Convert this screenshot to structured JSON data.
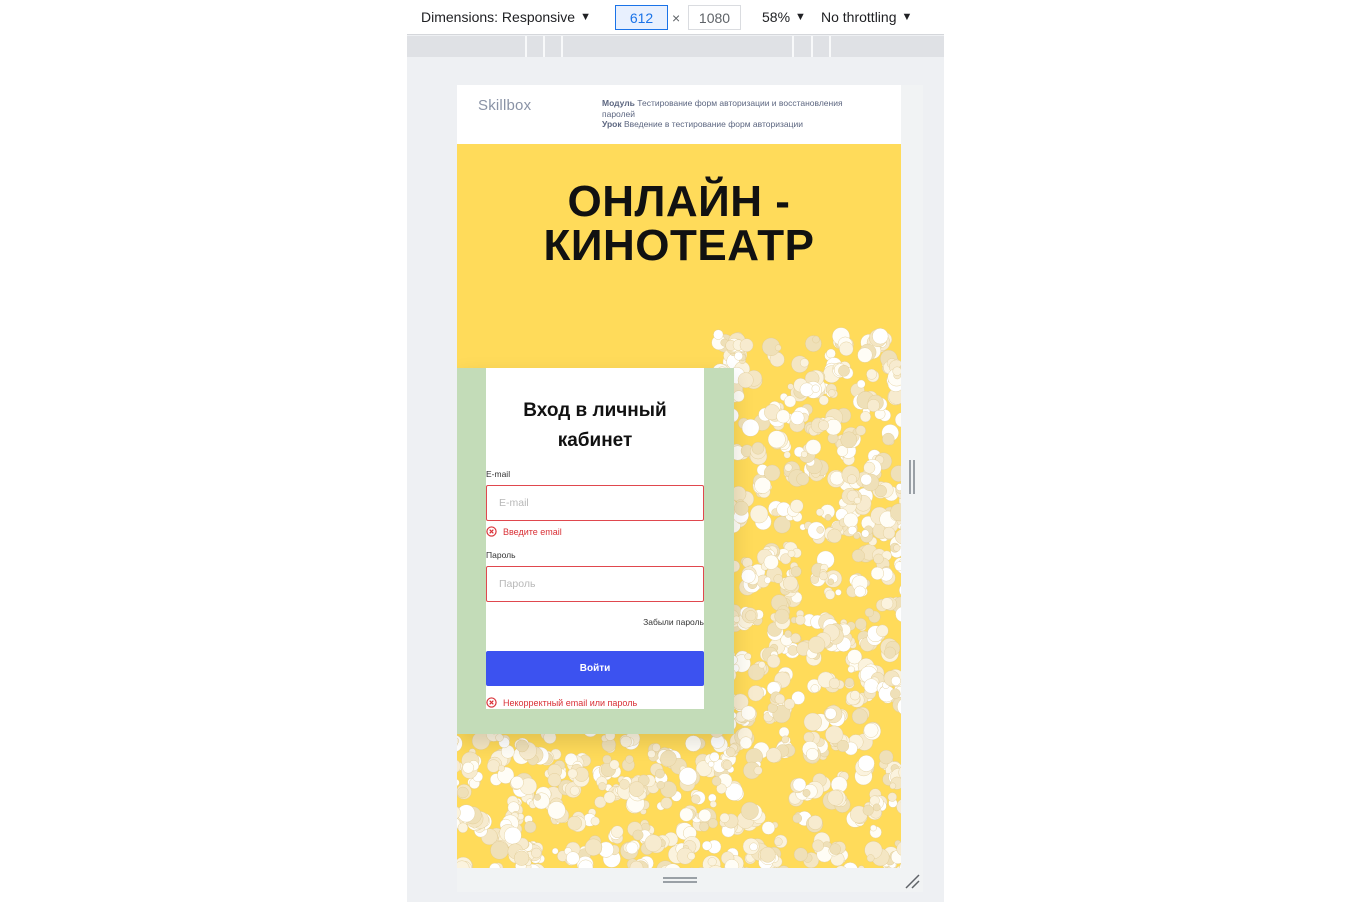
{
  "devtools": {
    "dimensions_label": "Dimensions: Responsive",
    "width_value": "612",
    "times_symbol": "×",
    "height_value": "1080",
    "zoom_label": "58%",
    "throttle_label": "No throttling",
    "dropdown_arrow": "▼"
  },
  "page": {
    "logo": "Skillbox",
    "module_label": "Модуль",
    "module_text": "Тестирование форм авторизации и восстановления паролей",
    "lesson_label": "Урок",
    "lesson_text": "Введение в тестирование форм авторизации",
    "hero_title_line1": "ОНЛАЙН -",
    "hero_title_line2": "КИНОТЕАТР"
  },
  "login": {
    "title_line1": "Вход в личный",
    "title_line2": "кабинет",
    "email_label": "E-mail",
    "email_placeholder": "E-mail",
    "email_error": "Введите email",
    "password_label": "Пароль",
    "password_placeholder": "Пароль",
    "forgot_link": "Забыли пароль",
    "submit_label": "Войти",
    "form_error": "Некорректный email или пароль"
  },
  "colors": {
    "hero_background": "#ffdb5a",
    "card_border": "#c3dcb8",
    "submit_button": "#3c52f0",
    "error": "#d93036"
  }
}
